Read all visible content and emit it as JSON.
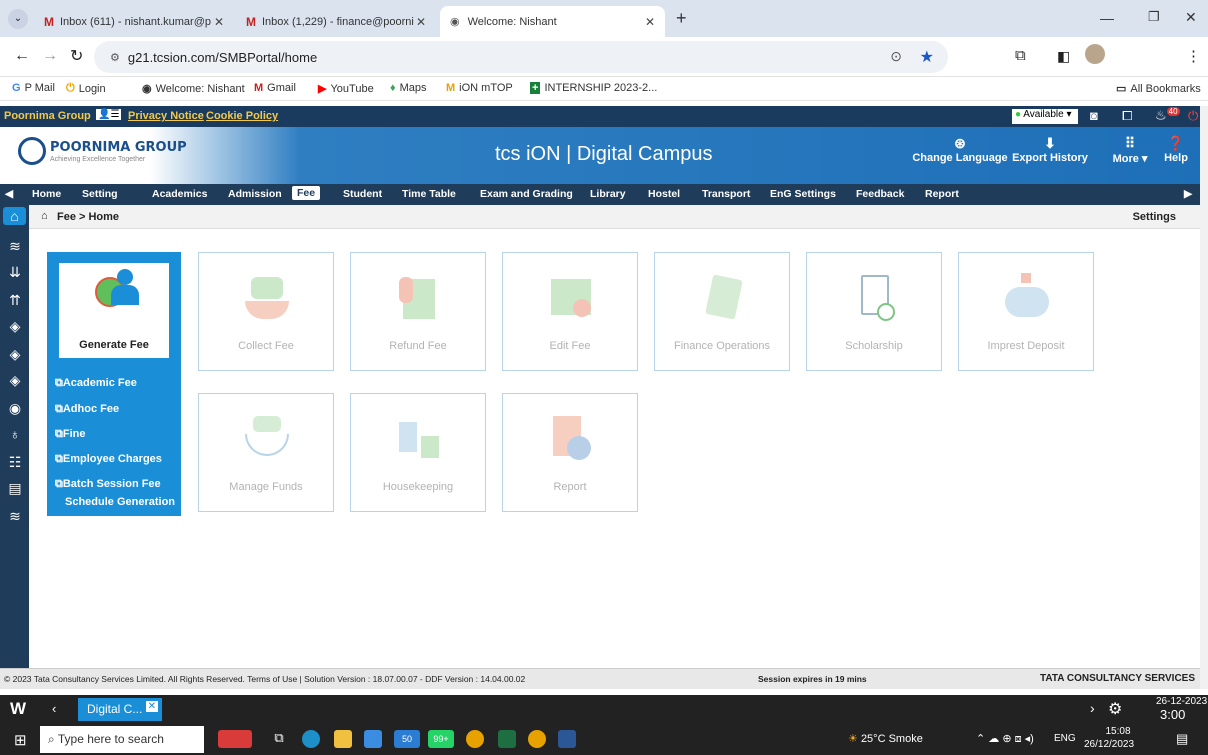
{
  "browser": {
    "tabs": [
      {
        "title": "Inbox (611) - nishant.kumar@p",
        "icon": "gmail-icon"
      },
      {
        "title": "Inbox (1,229) - finance@poorni",
        "icon": "gmail-icon"
      },
      {
        "title": "Welcome: Nishant",
        "icon": "globe-icon"
      }
    ],
    "url": "g21.tcsion.com/SMBPortal/home",
    "bookmarks": [
      "P Mail",
      "Login",
      "Welcome: Nishant",
      "Gmail",
      "YouTube",
      "Maps",
      "iON mTOP",
      "INTERNSHIP 2023-2..."
    ],
    "all_bookmarks": "All Bookmarks",
    "profile_badge": "40"
  },
  "portal": {
    "group_label": "Poornima Group",
    "privacy": "Privacy Notice",
    "cookie": "Cookie Policy",
    "status": "Available",
    "logo_name": "POORNIMA GROUP",
    "logo_tagline": "Achieving Excellence Together",
    "brand": "tcs iON | Digital Campus",
    "change_language": "Change Language",
    "export_history": "Export History",
    "more": "More",
    "help": "Help"
  },
  "nav": [
    "Home",
    "Setting",
    "Academics",
    "Admission",
    "Fee",
    "Student",
    "Time Table",
    "Exam and Grading",
    "Library",
    "Hostel",
    "Transport",
    "EnG Settings",
    "Feedback",
    "Report"
  ],
  "nav_active": "Fee",
  "breadcrumb": "Fee > Home",
  "settings": "Settings",
  "generate": {
    "title": "Generate Fee",
    "links": [
      "Academic Fee",
      "Adhoc Fee",
      "Fine",
      "Employee Charges",
      "Batch Session Fee",
      "Schedule Generation"
    ]
  },
  "tiles": [
    "Collect Fee",
    "Refund Fee",
    "Edit Fee",
    "Finance Operations",
    "Scholarship",
    "Imprest Deposit",
    "Manage Funds",
    "Housekeeping",
    "Report"
  ],
  "footer": {
    "copyright": "© 2023 Tata Consultancy Services Limited. All Rights Reserved.   Terms of Use | Solution Version : 18.07.00.07 - DDF Version : 14.04.00.02",
    "session": "Session expires in 19 mins",
    "tcs": "TATA CONSULTANCY SERVICES"
  },
  "appbar": {
    "task": "Digital C...",
    "date": "26-12-2023",
    "time": "3:00 PM"
  },
  "taskbar": {
    "search": "Type here to search",
    "weather": "25°C  Smoke",
    "lang": "ENG",
    "time": "15:08",
    "date": "26/12/2023",
    "badge_a": "50",
    "badge_b": "99+"
  }
}
